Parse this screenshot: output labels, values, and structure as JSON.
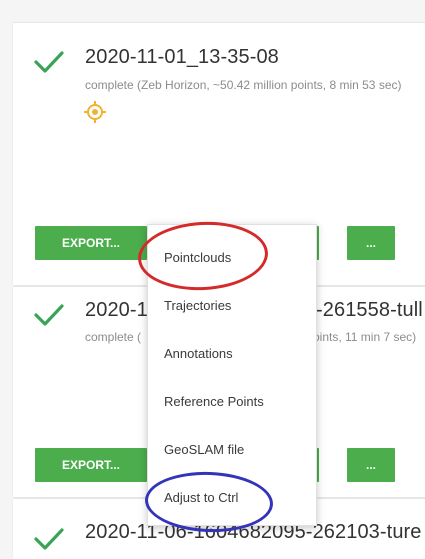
{
  "colors": {
    "accent": "#4bad4c",
    "check": "#3aa356",
    "target_icon": "#f2b230",
    "annotation_red": "#d42a2a",
    "annotation_blue": "#3334b8"
  },
  "cards": [
    {
      "title": "2020-11-01_13-35-08",
      "status": "complete (Zeb Horizon, ~50.42 million points, 8 min 53 sec)",
      "export_label": "EXPORT...",
      "more_label": "..."
    },
    {
      "title_left": "2020-1",
      "title_right": "-261558-tull",
      "status_left": "complete (",
      "status_right": "oints, 11 min 7 sec)",
      "export_label": "EXPORT...",
      "more_label": "..."
    },
    {
      "title": "2020-11-06-1604682095-262103-ture"
    }
  ],
  "export_menu": {
    "items": [
      "Pointclouds",
      "Trajectories",
      "Annotations",
      "Reference Points",
      "GeoSLAM file",
      "Adjust to Ctrl"
    ]
  },
  "icons": [
    "check-icon",
    "target-icon"
  ]
}
